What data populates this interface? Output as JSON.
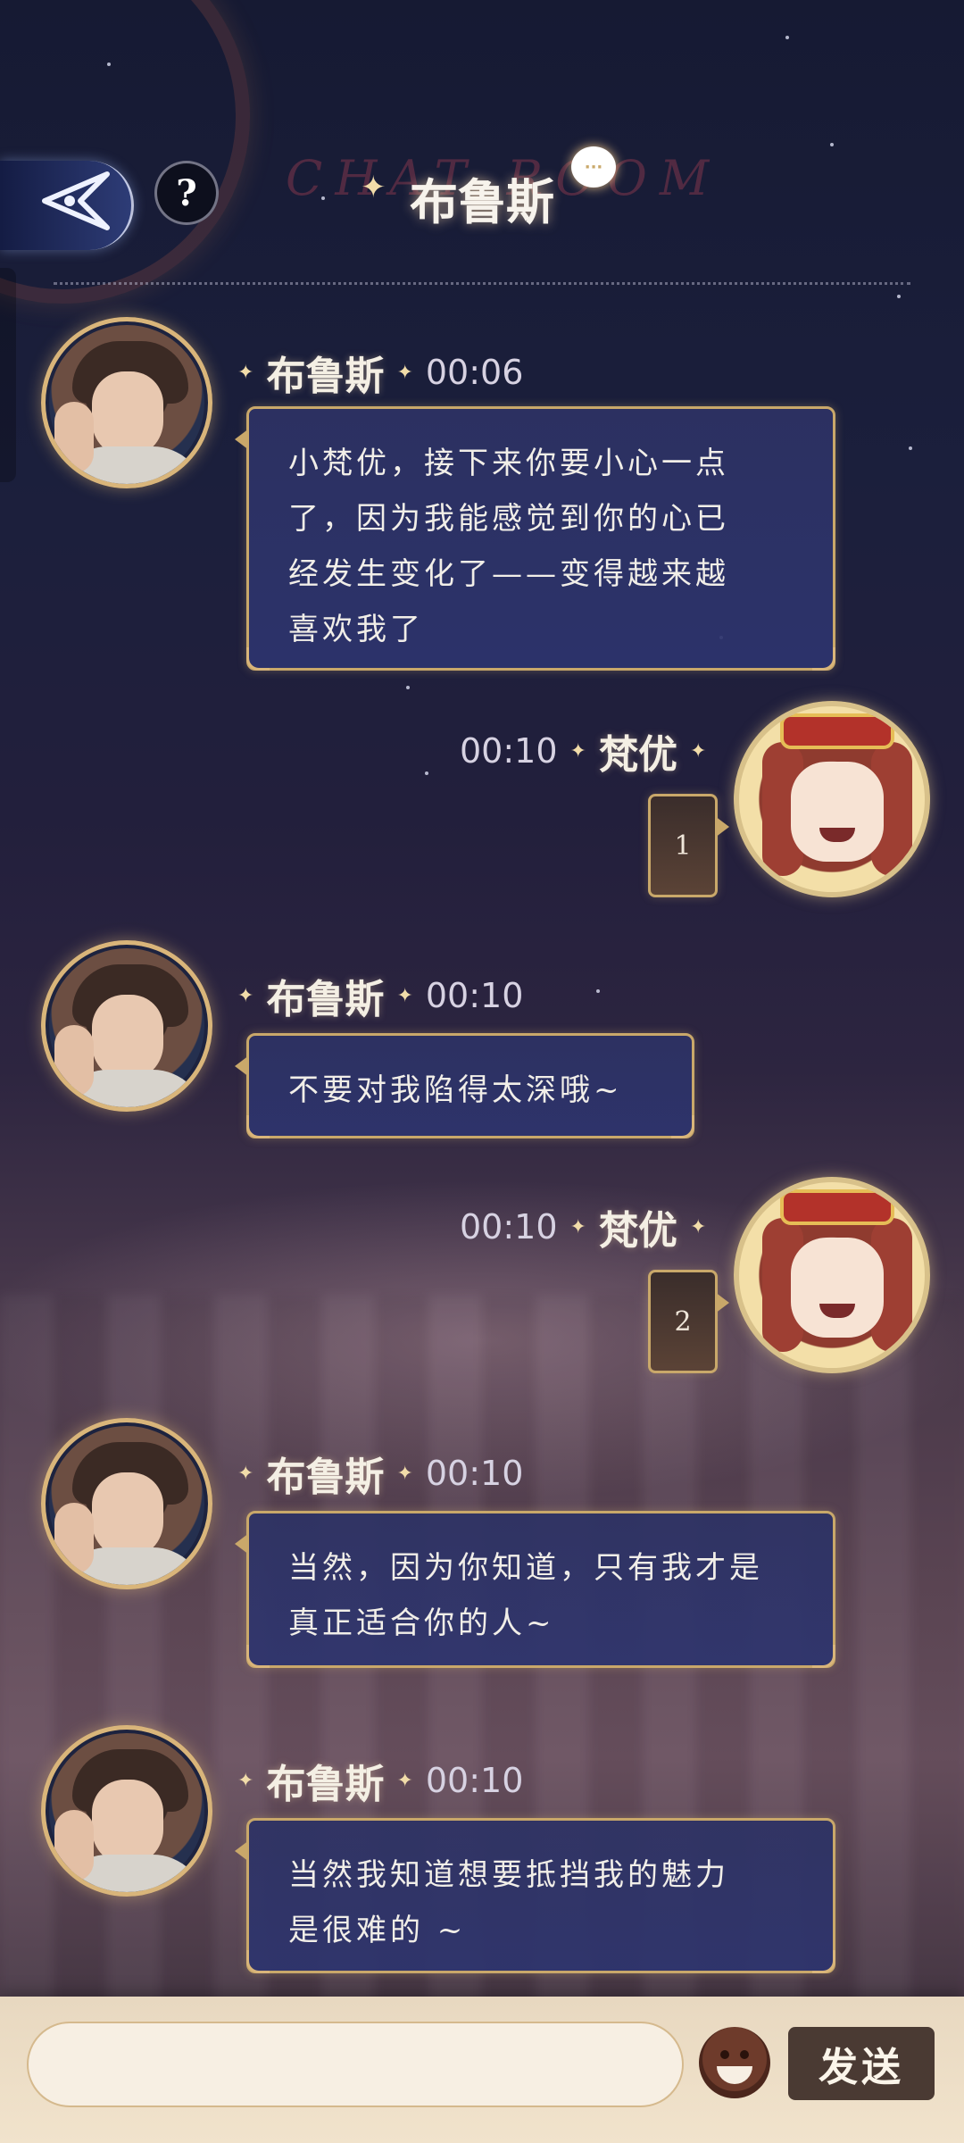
{
  "header": {
    "title": "布鲁斯",
    "watermark": "CHAT ROOM",
    "help_label": "?"
  },
  "messages": [
    {
      "sender": "布鲁斯",
      "time": "00:06",
      "side": "left",
      "lines": [
        "小梵优，接下来你要小心一点",
        "了，因为我能感觉到你的心已",
        "经发生变化了——变得越来越",
        "喜欢我了"
      ]
    },
    {
      "sender": "梵优",
      "time": "00:10",
      "side": "right",
      "text": "1"
    },
    {
      "sender": "布鲁斯",
      "time": "00:10",
      "side": "left",
      "lines": [
        "不要对我陷得太深哦~"
      ]
    },
    {
      "sender": "梵优",
      "time": "00:10",
      "side": "right",
      "text": "2"
    },
    {
      "sender": "布鲁斯",
      "time": "00:10",
      "side": "left",
      "lines": [
        "当然，因为你知道，只有我才是",
        "真正适合你的人~"
      ]
    },
    {
      "sender": "布鲁斯",
      "time": "00:10",
      "side": "left",
      "lines": [
        "当然我知道想要抵挡我的魅力",
        "是很难的 ~"
      ]
    }
  ],
  "input_bar": {
    "placeholder": "",
    "send_label": "发送"
  },
  "colors": {
    "accent_gold": "#c9a86a",
    "bubble_blue": "#2d3264",
    "send_button": "#4a3a33"
  }
}
